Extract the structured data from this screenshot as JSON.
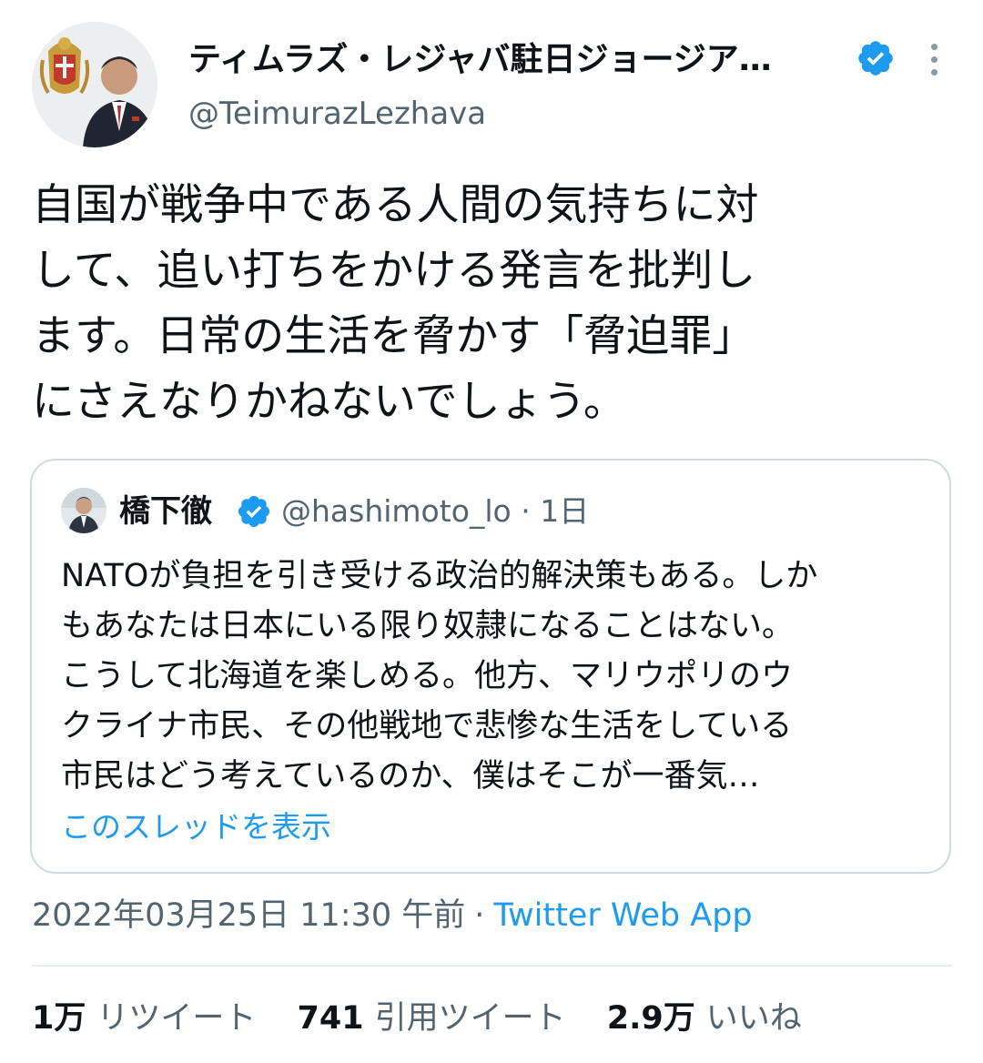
{
  "author": {
    "display_name": "ティムラズ・レジャバ駐日ジョージア…",
    "handle": "@TeimurazLezhava",
    "verified_icon": "verified-badge-icon"
  },
  "tweet": {
    "lines": [
      "自国が戦争中である人間の気持ちに対",
      "して、追い打ちをかける発言を批判し",
      "ます。日常の生活を脅かす「脅迫罪」",
      "にさえなりかねないでしょう。"
    ]
  },
  "quoted": {
    "name": "橋下徹",
    "handle_time": "@hashimoto_lo · 1日",
    "lines": [
      "NATOが負担を引き受ける政治的解決策もある。しか",
      "もあなたは日本にいる限り奴隷になることはない。",
      "こうして北海道を楽しめる。他方、マリウポリのウ",
      "クライナ市民、その他戦地で悲惨な生活をしている",
      "市民はどう考えているのか、僕はそこが一番気…"
    ],
    "show_thread": "このスレッドを表示"
  },
  "meta": {
    "datetime": "2022年03月25日 11:30 午前",
    "separator": "·",
    "source": "Twitter Web App"
  },
  "stats": {
    "retweets_count": "1万",
    "retweets_label": "リツイート",
    "quotes_count": "741",
    "quotes_label": "引用ツイート",
    "likes_count": "2.9万",
    "likes_label": "いいね"
  },
  "colors": {
    "accent": "#1d9bf0",
    "text": "#0f1419",
    "secondary": "#536471",
    "border": "#cfd9de"
  }
}
